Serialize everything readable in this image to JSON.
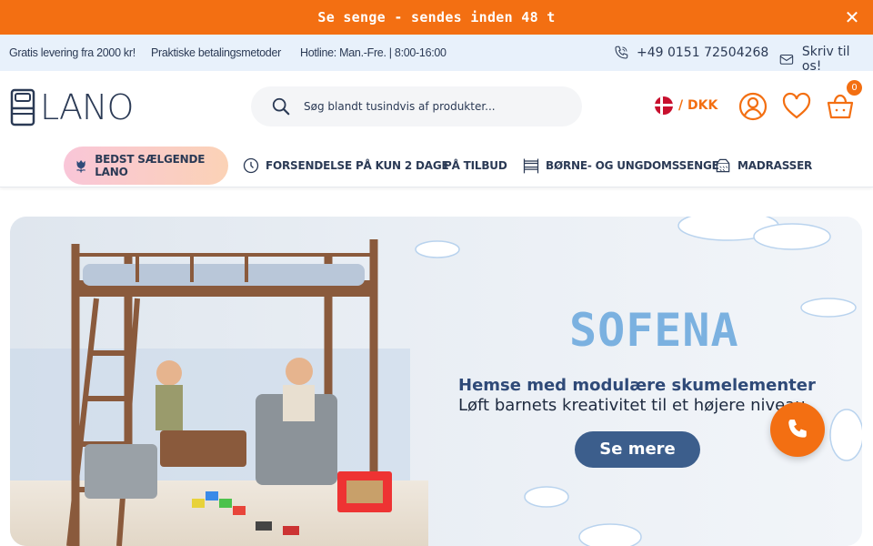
{
  "announcement": {
    "text": "Se senge - sendes inden 48 t",
    "close_icon": "close-icon"
  },
  "infobar": {
    "shipping": "Gratis levering fra 2000 kr!",
    "payment": "Praktiske betalingsmetoder",
    "hotline": "Hotline: Man.-Fre. | 8:00-16:00",
    "phone": "+49 0151 72504268",
    "contact": "Skriv til os!"
  },
  "header": {
    "logo_text": "LANO",
    "search_placeholder": "Søg blandt tusindvis af produkter...",
    "currency": "/ DKK",
    "cart_count": "0"
  },
  "nav": [
    {
      "label": "BEDST SÆLGENDE LANO",
      "icon": "tulip-icon"
    },
    {
      "label": "FORSENDELSE PÅ KUN 2 DAGE",
      "icon": "clock-icon"
    },
    {
      "label": "PÅ TILBUD",
      "icon": ""
    },
    {
      "label": "BØRNE- OG UNGDOMSSENGE",
      "icon": "bunk-bed-icon"
    },
    {
      "label": "MADRASSER",
      "icon": "mattress-icon"
    }
  ],
  "hero": {
    "brand": "SOFENA",
    "headline": "Hemse med modulære skumelementer",
    "subline": "Løft barnets kreativitet til et højere niveau",
    "cta": "Se mere"
  },
  "colors": {
    "accent": "#f36f12",
    "navy": "#2b3a55",
    "hero_button": "#3c5e8c",
    "brand_blue": "#7bb1e0"
  }
}
